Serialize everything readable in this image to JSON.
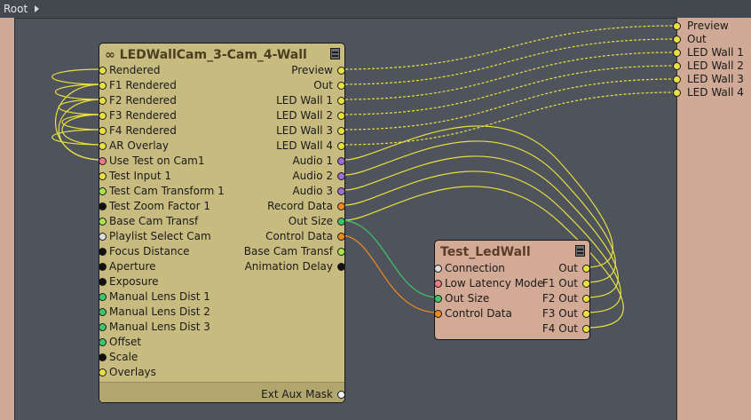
{
  "breadcrumb": {
    "root": "Root"
  },
  "main_node": {
    "title": "LEDWallCam_3-Cam_4-Wall",
    "inputs": [
      {
        "label": "Rendered",
        "color": "#e8e140"
      },
      {
        "label": "F1 Rendered",
        "color": "#e8e140"
      },
      {
        "label": "F2 Rendered",
        "color": "#e8e140"
      },
      {
        "label": "F3 Rendered",
        "color": "#e8e140"
      },
      {
        "label": "F4 Rendered",
        "color": "#e8e140"
      },
      {
        "label": "AR Overlay",
        "color": "#e8e140"
      },
      {
        "label": "Use Test on Cam1",
        "color": "#e87a8a"
      },
      {
        "label": "Test Input 1",
        "color": "#e8e140"
      },
      {
        "label": "Test Cam Transform 1",
        "color": "#a8e34a"
      },
      {
        "label": "Test Zoom Factor 1",
        "color": "#111111"
      },
      {
        "label": "Base Cam Transf",
        "color": "#a8e34a"
      },
      {
        "label": "Playlist Select Cam",
        "color": "#dddddd"
      },
      {
        "label": "Focus Distance",
        "color": "#111111"
      },
      {
        "label": "Aperture",
        "color": "#111111"
      },
      {
        "label": "Exposure",
        "color": "#111111"
      },
      {
        "label": "Manual Lens Dist 1",
        "color": "#3fc46b"
      },
      {
        "label": "Manual Lens Dist 2",
        "color": "#3fc46b"
      },
      {
        "label": "Manual Lens Dist 3",
        "color": "#3fc46b"
      },
      {
        "label": "Offset",
        "color": "#3fc46b"
      },
      {
        "label": "Scale",
        "color": "#111111"
      },
      {
        "label": "Overlays",
        "color": "#e8e140"
      }
    ],
    "outputs": [
      {
        "label": "Preview",
        "color": "#e8e140"
      },
      {
        "label": "Out",
        "color": "#e8e140"
      },
      {
        "label": "LED Wall 1",
        "color": "#e8e140"
      },
      {
        "label": "LED Wall 2",
        "color": "#e8e140"
      },
      {
        "label": "LED Wall 3",
        "color": "#e8e140"
      },
      {
        "label": "LED Wall 4",
        "color": "#e8e140"
      },
      {
        "label": "Audio 1",
        "color": "#9a6fd6"
      },
      {
        "label": "Audio 2",
        "color": "#9a6fd6"
      },
      {
        "label": "Audio 3",
        "color": "#9a6fd6"
      },
      {
        "label": "Record Data",
        "color": "#f08a1c"
      },
      {
        "label": "Out Size",
        "color": "#3fc46b"
      },
      {
        "label": "Control Data",
        "color": "#f08a1c"
      },
      {
        "label": "Base Cam Transf",
        "color": "#a8e34a"
      },
      {
        "label": "Animation Delay",
        "color": "#111111"
      }
    ],
    "footer_output": {
      "label": "Ext Aux Mask",
      "color": "#f2f2f2"
    }
  },
  "test_node": {
    "title": "Test_LedWall",
    "inputs": [
      {
        "label": "Connection",
        "color": "#dddddd"
      },
      {
        "label": "Low Latency Mode",
        "color": "#e87a8a"
      },
      {
        "label": "Out Size",
        "color": "#3fc46b"
      },
      {
        "label": "Control Data",
        "color": "#f08a1c"
      }
    ],
    "outputs": [
      {
        "label": "Out",
        "color": "#e8e140"
      },
      {
        "label": "F1 Out",
        "color": "#e8e140"
      },
      {
        "label": "F2 Out",
        "color": "#e8e140"
      },
      {
        "label": "F3 Out",
        "color": "#e8e140"
      },
      {
        "label": "F4 Out",
        "color": "#e8e140"
      }
    ]
  },
  "output_rail": {
    "ports": [
      "Preview",
      "Out",
      "LED Wall 1",
      "LED Wall 2",
      "LED Wall 3",
      "LED Wall 4"
    ]
  },
  "colors": {
    "wire_yellow": "#e8e140",
    "wire_orange": "#f08a1c",
    "wire_green": "#3fc46b",
    "main_node_bg": "#c8bb80",
    "test_node_bg": "#d3aa96",
    "rail_bg": "#d0aa97",
    "canvas_bg": "#4e535c"
  },
  "icons": {
    "link": "link-icon",
    "menu": "node-menu-icon",
    "breadcrumb_arrow": "chevron-right-icon"
  }
}
